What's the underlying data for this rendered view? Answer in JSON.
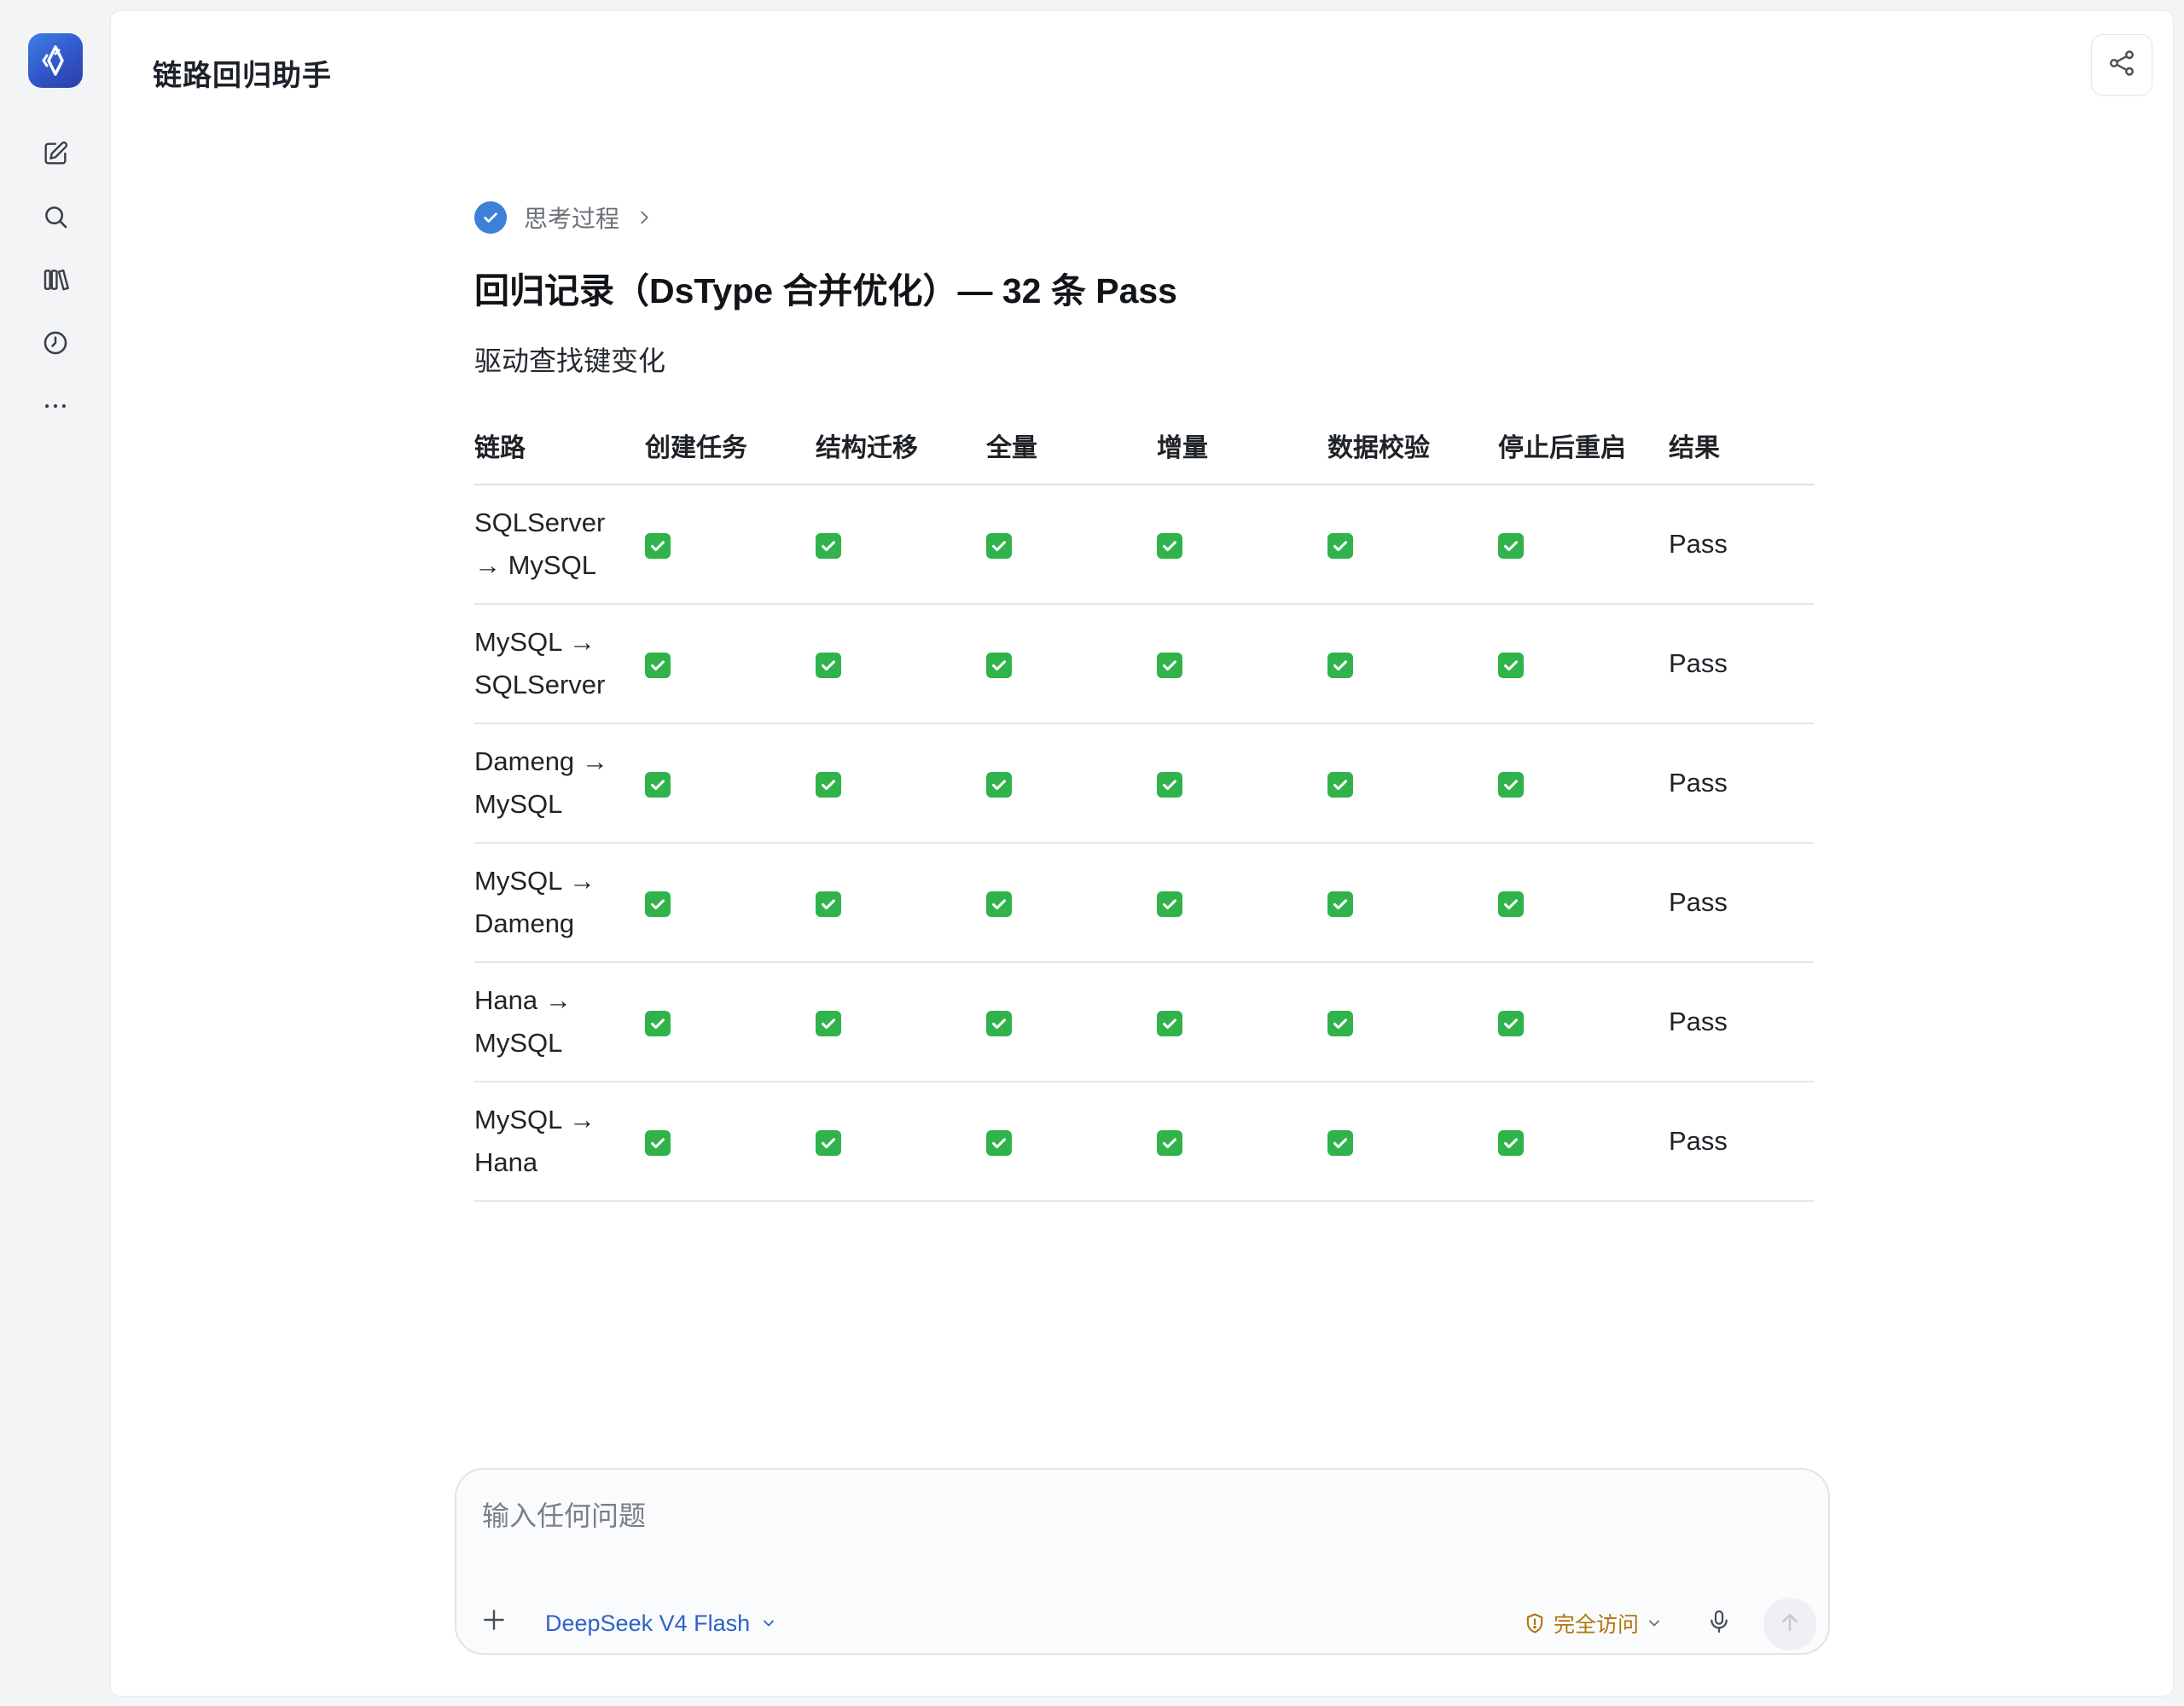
{
  "app": {
    "title": "链路回归助手",
    "accent": "#3d7fd9"
  },
  "rail": {
    "logo_icon": "app-logo-icon",
    "items": [
      {
        "icon": "new-chat-icon"
      },
      {
        "icon": "search-icon"
      },
      {
        "icon": "library-icon"
      },
      {
        "icon": "history-icon"
      },
      {
        "icon": "more-icon"
      }
    ]
  },
  "header": {
    "share_icon": "share-icon"
  },
  "message": {
    "thinking_label": "思考过程",
    "title": "回归记录（DsType 合并优化）— 32 条 Pass",
    "subtitle": "驱动查找键变化",
    "table": {
      "headers": [
        "链路",
        "创建任务",
        "结构迁移",
        "全量",
        "增量",
        "数据校验",
        "停止后重启",
        "结果"
      ],
      "rows": [
        {
          "link": "SQLServer → MySQL",
          "checks": [
            true,
            true,
            true,
            true,
            true,
            true
          ],
          "result": "Pass"
        },
        {
          "link": "MySQL → SQLServer",
          "checks": [
            true,
            true,
            true,
            true,
            true,
            true
          ],
          "result": "Pass"
        },
        {
          "link": "Dameng → MySQL",
          "checks": [
            true,
            true,
            true,
            true,
            true,
            true
          ],
          "result": "Pass"
        },
        {
          "link": "MySQL → Dameng",
          "checks": [
            true,
            true,
            true,
            true,
            true,
            true
          ],
          "result": "Pass"
        },
        {
          "link": "Hana → MySQL",
          "checks": [
            true,
            true,
            true,
            true,
            true,
            true
          ],
          "result": "Pass"
        },
        {
          "link": "MySQL → Hana",
          "checks": [
            true,
            true,
            true,
            true,
            true,
            true
          ],
          "result": "Pass"
        }
      ],
      "check_color": "#2fb34a"
    }
  },
  "composer": {
    "placeholder": "输入任何问题",
    "value": "",
    "model_label": "DeepSeek V4 Flash",
    "access_label": "完全访问",
    "model_color": "#2f62c9",
    "access_color": "#b07410"
  }
}
